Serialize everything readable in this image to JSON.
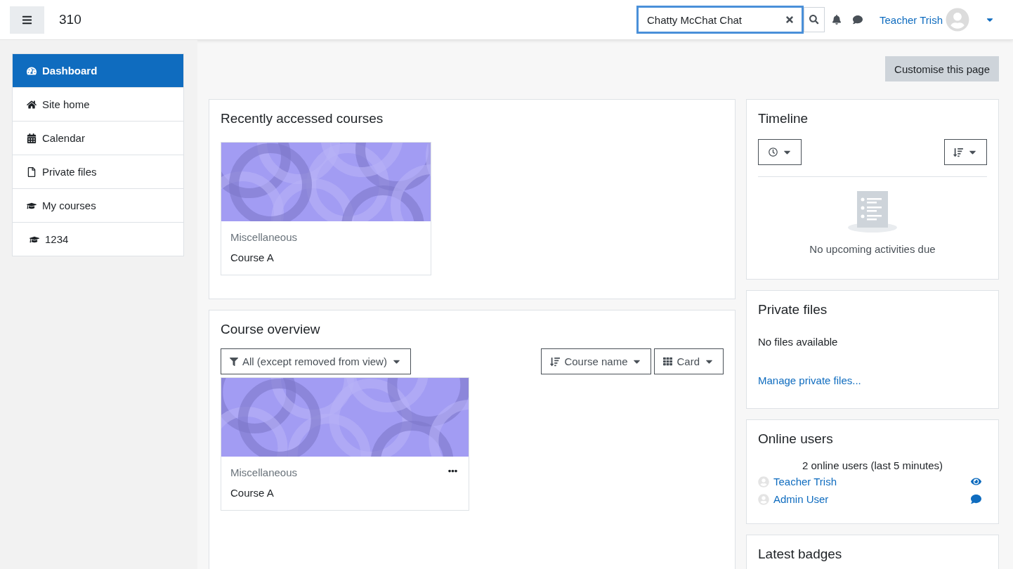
{
  "navbar": {
    "site_name": "310",
    "search": {
      "value": "Chatty McChat Chat"
    },
    "user": {
      "name": "Teacher Trish"
    }
  },
  "sidebar": {
    "items": [
      {
        "label": "Dashboard",
        "selected": true
      },
      {
        "label": "Site home",
        "selected": false
      },
      {
        "label": "Calendar",
        "selected": false
      },
      {
        "label": "Private files",
        "selected": false
      },
      {
        "label": "My courses",
        "selected": false,
        "children": [
          {
            "label": "1234",
            "selected": false
          }
        ]
      }
    ]
  },
  "customise_button": "Customise this page",
  "recently_accessed": {
    "title": "Recently accessed courses",
    "courses": [
      {
        "category": "Miscellaneous",
        "name": "Course A"
      }
    ]
  },
  "course_overview": {
    "title": "Course overview",
    "filter": "All (except removed from view)",
    "sort": "Course name",
    "view": "Card",
    "courses": [
      {
        "category": "Miscellaneous",
        "name": "Course A"
      }
    ]
  },
  "timeline": {
    "title": "Timeline",
    "empty_text": "No upcoming activities due"
  },
  "private_files": {
    "title": "Private files",
    "empty_text": "No files available",
    "link": "Manage private files..."
  },
  "online_users": {
    "title": "Online users",
    "summary": "2 online users (last 5 minutes)",
    "users": [
      {
        "name": "Teacher Trish"
      },
      {
        "name": "Admin User"
      }
    ]
  },
  "latest_badges": {
    "title": "Latest badges"
  }
}
